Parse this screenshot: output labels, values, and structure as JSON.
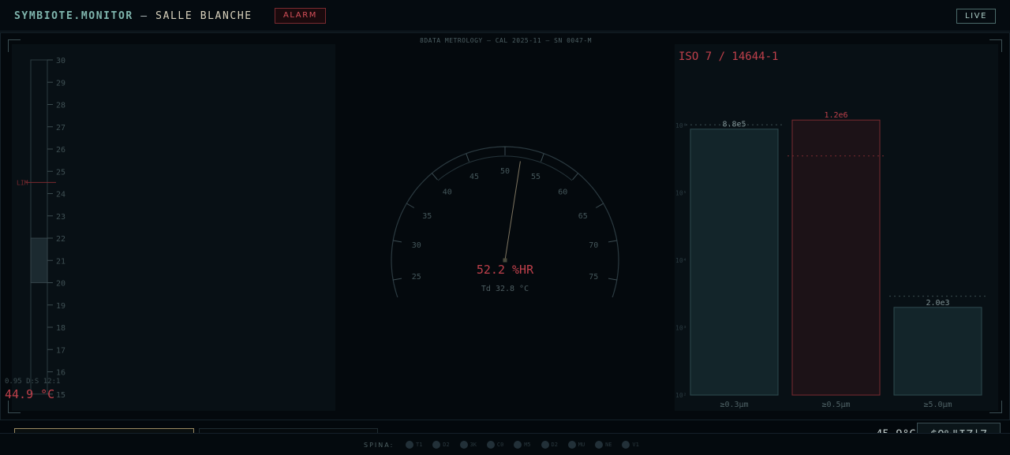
{
  "header": {
    "brand": "SYMBIOTE.MONITOR",
    "separator": "—",
    "room": "SALLE BLANCHE",
    "alarm_label": "ALARM",
    "live_label": "LIVE"
  },
  "metrology_caption": "8DATA METROLOGY — CAL 2025-11 — SN 0047-M",
  "thermometer": {
    "scale": [
      "30",
      "29",
      "28",
      "27",
      "26",
      "25",
      "24",
      "23",
      "22",
      "21",
      "20",
      "19",
      "18",
      "17",
      "16",
      "15"
    ],
    "limit_label": "LIM",
    "limit_value": 24.5,
    "band_low": 20,
    "band_high": 22,
    "meta": "0.95  D:S 12:1",
    "reading": "44.9 °C"
  },
  "hygrometer": {
    "min": 20,
    "max": 80,
    "ticks": [
      "20",
      "25",
      "30",
      "35",
      "40",
      "45",
      "50",
      "55",
      "60",
      "65",
      "70",
      "75",
      "80"
    ],
    "value": 52.2,
    "reading": "52.2 %HR",
    "dewpoint": "Td 32.8 °C"
  },
  "particles": {
    "title": "ISO 7 / 14644-1",
    "axis_ticks": [
      "10⁶",
      "10⁵",
      "10⁴",
      "10³",
      "10²"
    ],
    "bars": [
      {
        "category": "≥0.3µm",
        "label": "8.8e5",
        "value": 880000,
        "limit": 1020000,
        "alarm": false
      },
      {
        "category": "≥0.5µm",
        "label": "1.2e6",
        "value": 1200000,
        "limit": 352000,
        "alarm": true
      },
      {
        "category": "≥5.0µm",
        "label": "2.0e3",
        "value": 2000,
        "limit": 2930,
        "alarm": false
      }
    ],
    "colors": {
      "normal": "#13252a",
      "alarm": "#1c1217",
      "alarm_stroke": "#7a2a30",
      "normal_stroke": "#2e4a4f"
    }
  },
  "tabs": [
    {
      "label": "PAGE 1 · THERMO/HYGRO/PART",
      "active": true
    },
    {
      "label": "PAGE 2 · MANO/ANEMO/GEIGER",
      "active": false
    }
  ],
  "clock": {
    "ghost": "45.9°C",
    "box": "$0%\"IZ|7"
  },
  "spina": {
    "label": "SPINA:",
    "nodes": [
      "T1",
      "D2",
      "3K",
      "C0",
      "M5",
      "D2",
      "MU",
      "NE",
      "V1"
    ]
  }
}
